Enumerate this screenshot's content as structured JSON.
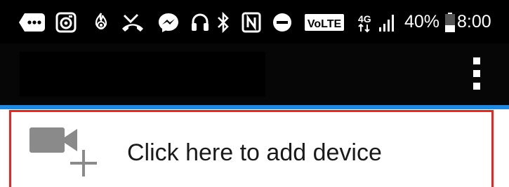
{
  "status_bar": {
    "icons": [
      "more-chat-icon",
      "camera-lens-icon",
      "fire-icon",
      "missed-call-icon",
      "messenger-icon",
      "headset-icon",
      "bluetooth-icon",
      "nfc-icon",
      "do-not-disturb-icon",
      "volte-icon",
      "4g-icon",
      "signal-icon",
      "battery-icon"
    ],
    "volte_label": "VoLTE",
    "network_label": "4G",
    "battery": "40%",
    "battery_level": 0.4,
    "time": "8:00"
  },
  "app_bar": {
    "title": "",
    "menu_icon": "more-vert-icon"
  },
  "add_device": {
    "label": "Click here to add device",
    "icon": "add-video-camera-icon",
    "highlight_color": "#ee2222"
  },
  "colors": {
    "accent": "#1e88e5",
    "status_bar_bg": "#000000",
    "app_bar_bg": "#060606"
  }
}
